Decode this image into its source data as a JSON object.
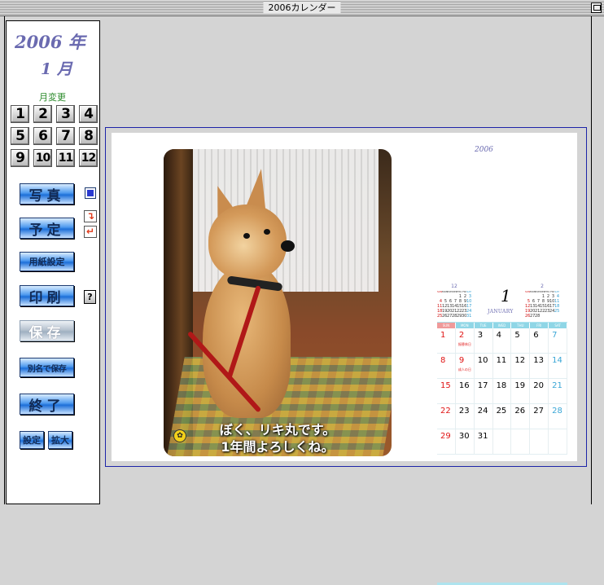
{
  "window": {
    "title": "2006カレンダー"
  },
  "sidebar": {
    "year": "2006 年",
    "month": "1 月",
    "month_change_label": "月変更",
    "months": [
      "1",
      "2",
      "3",
      "4",
      "5",
      "6",
      "7",
      "8",
      "9",
      "10",
      "11",
      "12"
    ],
    "buttons": {
      "photo": "写真",
      "schedule": "予定",
      "paper_setup": "用紙設定",
      "print": "印刷",
      "help": "?",
      "save": "保存",
      "save_as": "別名で保存",
      "quit": "終了",
      "settings": "設定",
      "zoom": "拡大"
    },
    "icons": {
      "photo_option": "square-icon",
      "schedule_arrows": "undo-redo-arrows-icon",
      "help": "help-icon"
    }
  },
  "canvas": {
    "calendar_year": "2006",
    "photo_caption_line1": "ぼく、リキ丸です。",
    "photo_caption_line2": "1年間よろしくね。",
    "month_number": "1",
    "month_name": "JANUARY",
    "weekday_headers": [
      "SUN",
      "MON",
      "TUE",
      "WED",
      "THU",
      "FRI",
      "SAT"
    ],
    "prev_month": {
      "label": "12",
      "rows": [
        [
          "",
          "",
          "",
          "",
          "1",
          "2",
          "3"
        ],
        [
          "4",
          "5",
          "6",
          "7",
          "8",
          "9",
          "10"
        ],
        [
          "11",
          "12",
          "13",
          "14",
          "15",
          "16",
          "17"
        ],
        [
          "18",
          "19",
          "20",
          "21",
          "22",
          "23",
          "24"
        ],
        [
          "25",
          "26",
          "27",
          "28",
          "29",
          "30",
          "31"
        ]
      ]
    },
    "next_month": {
      "label": "2",
      "rows": [
        [
          "",
          "",
          "",
          "1",
          "2",
          "3",
          "4"
        ],
        [
          "5",
          "6",
          "7",
          "8",
          "9",
          "10",
          "11"
        ],
        [
          "12",
          "13",
          "14",
          "15",
          "16",
          "17",
          "18"
        ],
        [
          "19",
          "20",
          "21",
          "22",
          "23",
          "24",
          "25"
        ],
        [
          "26",
          "27",
          "28",
          "",
          "",
          "",
          ""
        ]
      ]
    },
    "weeks": [
      [
        "1",
        "2",
        "3",
        "4",
        "5",
        "6",
        "7"
      ],
      [
        "8",
        "9",
        "10",
        "11",
        "12",
        "13",
        "14"
      ],
      [
        "15",
        "16",
        "17",
        "18",
        "19",
        "20",
        "21"
      ],
      [
        "22",
        "23",
        "24",
        "25",
        "26",
        "27",
        "28"
      ],
      [
        "29",
        "30",
        "31",
        "",
        "",
        "",
        ""
      ]
    ],
    "holidays": {
      "2": "振替休日",
      "9": "成人の日"
    }
  },
  "colors": {
    "accent": "#6a6ab0",
    "canvas_border": "#1d24a8",
    "button_blue": "#1d6fd8",
    "holiday_red": "#e01414",
    "saturday_blue": "#39a6d6"
  }
}
